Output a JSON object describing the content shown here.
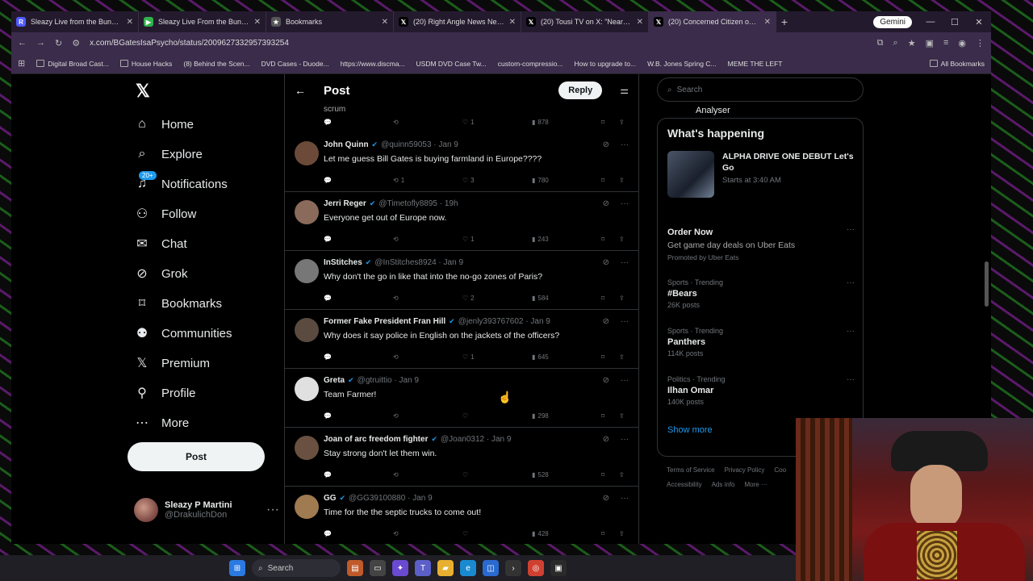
{
  "browser": {
    "tabs": [
      {
        "title": "Sleazy Live from the Bunker 1/1",
        "icon": "R",
        "color": "#4e5bff"
      },
      {
        "title": "Sleazy Live From the Bunker 1/1",
        "icon": "▶",
        "color": "#2fb24a"
      },
      {
        "title": "Bookmarks",
        "icon": "★",
        "color": "#555"
      },
      {
        "title": "(20) Right Angle News Network",
        "icon": "𝕏",
        "color": "#000"
      },
      {
        "title": "(20) Tousi TV on X: \"Nearly 24 h",
        "icon": "𝕏",
        "color": "#000"
      },
      {
        "title": "(20) Concerned Citizen on X: \"",
        "icon": "𝕏",
        "color": "#000"
      }
    ],
    "gemini_label": "Gemini",
    "url": "x.com/BGatesIsaPsycho/status/2009627332957393254",
    "bookmarks": [
      "Digital Broad Cast...",
      "House Hacks",
      "(8) Behind the Scen...",
      "DVD Cases - Duode...",
      "https://www.discma...",
      "USDM DVD Case Tw...",
      "custom-compressio...",
      "How to upgrade to...",
      "W.B. Jones Spring C...",
      "MEME THE LEFT"
    ],
    "all_bookmarks": "All Bookmarks"
  },
  "nav": {
    "items": [
      {
        "label": "Home",
        "icon": "home-icon",
        "glyph": "⌂"
      },
      {
        "label": "Explore",
        "icon": "search-icon",
        "glyph": "⌕"
      },
      {
        "label": "Notifications",
        "icon": "bell-icon",
        "glyph": "🔔",
        "badge": "20+"
      },
      {
        "label": "Follow",
        "icon": "add-person-icon",
        "glyph": "⚇"
      },
      {
        "label": "Chat",
        "icon": "mail-icon",
        "glyph": "✉"
      },
      {
        "label": "Grok",
        "icon": "grok-icon",
        "glyph": "⊘"
      },
      {
        "label": "Bookmarks",
        "icon": "bookmark-icon",
        "glyph": "⌑"
      },
      {
        "label": "Communities",
        "icon": "communities-icon",
        "glyph": "⚉"
      },
      {
        "label": "Premium",
        "icon": "x-logo-icon",
        "glyph": "𝕏"
      },
      {
        "label": "Profile",
        "icon": "person-icon",
        "glyph": "⚲"
      },
      {
        "label": "More",
        "icon": "more-circle-icon",
        "glyph": "⋯"
      }
    ],
    "post_label": "Post",
    "profile_name": "Sleazy P Martini",
    "profile_handle": "@DrakulichDon"
  },
  "main": {
    "title": "Post",
    "reply_label": "Reply",
    "partial_text": "scrum",
    "partial_stats": {
      "likes": "1",
      "views": "878"
    },
    "replies": [
      {
        "name": "John Quinn",
        "handle": "@quinn59053 · Jan 9",
        "text": "Let me guess Bill Gates is buying farmland in Europe????",
        "retweets": "1",
        "likes": "3",
        "views": "780",
        "av": "#6b4a3a"
      },
      {
        "name": "Jerri Reger",
        "handle": "@Timetofly8895 · 19h",
        "text": "Everyone get out of Europe now.",
        "retweets": "",
        "likes": "1",
        "views": "243",
        "av": "#8a6a5a"
      },
      {
        "name": "InStitches",
        "handle": "@InStitches8924 · Jan 9",
        "text": "Why don't the go in like that into the no-go zones of Paris?",
        "retweets": "",
        "likes": "2",
        "views": "584",
        "av": "#777"
      },
      {
        "name": "Former Fake President Fran Hill",
        "handle": "@jenly393767602 · Jan 9",
        "text": "Why does it say police in English on the jackets of the officers?",
        "retweets": "",
        "likes": "1",
        "views": "645",
        "av": "#5a4a40"
      },
      {
        "name": "Greta",
        "handle": "@gtruittio · Jan 9",
        "text": "Team Farmer!",
        "retweets": "",
        "likes": "",
        "views": "298",
        "av": "#e0e0e0"
      },
      {
        "name": "Joan of arc freedom fighter",
        "handle": "@Joan0312 · Jan 9",
        "text": "Stay strong don't let them win.",
        "retweets": "",
        "likes": "",
        "views": "528",
        "av": "#6a5040"
      },
      {
        "name": "GG",
        "handle": "@GG39100880 · Jan 9",
        "text": "Time for the the septic trucks to come out!",
        "retweets": "",
        "likes": "",
        "views": "428",
        "av": "#a07a50"
      }
    ]
  },
  "right": {
    "search_placeholder": "Search",
    "analyser": "Analyser",
    "happening_title": "What's happening",
    "event_title": "ALPHA DRIVE ONE DEBUT Let's Go",
    "event_time": "Starts at 3:40 AM",
    "promo": {
      "name": "Order Now",
      "desc": "Get game day deals on Uber Eats",
      "tag": "Promoted by Uber Eats"
    },
    "trends": [
      {
        "meta": "Sports · Trending",
        "name": "#Bears",
        "count": "26K posts"
      },
      {
        "meta": "Sports · Trending",
        "name": "Panthers",
        "count": "114K posts"
      },
      {
        "meta": "Politics · Trending",
        "name": "Ilhan Omar",
        "count": "140K posts"
      }
    ],
    "show_more": "Show more",
    "footer": [
      "Terms of Service",
      "Privacy Policy",
      "Coo",
      "Accessibility",
      "Ads info",
      "More ···"
    ]
  },
  "taskbar": {
    "search_label": "Search"
  }
}
